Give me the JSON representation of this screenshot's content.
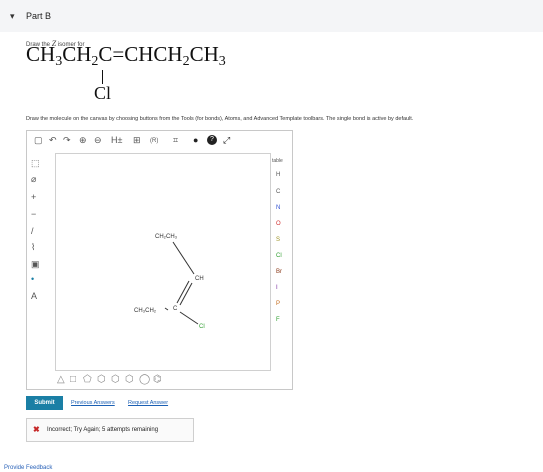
{
  "part": {
    "title": "Part B"
  },
  "question": {
    "instruction_prefix": "Draw the",
    "instruction_isomer": "Z",
    "instruction_suffix": "isomer for",
    "formula": {
      "p1": "CH",
      "s1": "3",
      "p2": "CH",
      "s2": "2",
      "p3": "C",
      "bond": "=",
      "p4": "CHCH",
      "s4": "2",
      "p5": "CH",
      "s5": "3",
      "substituent": "Cl"
    },
    "canvas_instruction": "Draw the molecule on the canvas by choosing buttons from the Tools (for bonds), Atoms, and Advanced Template toolbars. The single bond is active by default."
  },
  "editor": {
    "top_toolbar": [
      {
        "name": "document-icon",
        "glyph": "▢"
      },
      {
        "name": "undo-icon",
        "glyph": "↶"
      },
      {
        "name": "redo-icon",
        "glyph": "↷"
      },
      {
        "name": "zoom-in-icon",
        "glyph": "⊕"
      },
      {
        "name": "zoom-out-icon",
        "glyph": "⊖"
      },
      {
        "name": "hydrogen-toggle-icon",
        "glyph": "H±"
      },
      {
        "name": "label-icon",
        "glyph": "⊞"
      },
      {
        "name": "cip-icon",
        "glyph": "(R)"
      },
      {
        "name": "template-icon",
        "glyph": "⌗"
      },
      {
        "name": "info-icon",
        "glyph": "●"
      },
      {
        "name": "help-icon",
        "glyph": "?"
      },
      {
        "name": "fullscreen-icon",
        "glyph": "⤢"
      }
    ],
    "left_toolbar": [
      {
        "name": "select-icon",
        "glyph": "⬚"
      },
      {
        "name": "eraser-icon",
        "glyph": "⌀"
      },
      {
        "name": "charge-plus-icon",
        "glyph": "+"
      },
      {
        "name": "charge-minus-icon",
        "glyph": "−"
      },
      {
        "name": "single-bond-icon",
        "glyph": "/"
      },
      {
        "name": "chain-icon",
        "glyph": "⌇"
      },
      {
        "name": "ring-template-icon",
        "glyph": "▣"
      },
      {
        "name": "radical-icon",
        "glyph": "•"
      },
      {
        "name": "atom-label-icon",
        "glyph": "A"
      }
    ],
    "atoms": [
      "H",
      "C",
      "N",
      "O",
      "S",
      "Cl",
      "Br",
      "I",
      "P",
      "F"
    ],
    "atom_colors": {
      "H": "#555555",
      "C": "#555555",
      "N": "#3050d0",
      "O": "#d03030",
      "S": "#9a8f20",
      "Cl": "#2e9e2e",
      "Br": "#8b3a1a",
      "I": "#7a2ea0",
      "P": "#c46a1a",
      "F": "#2e9e2e"
    },
    "periodic_label": "table",
    "molecule_labels": {
      "top_group": "CH₂CH₃",
      "ch": "CH",
      "c": "C",
      "left_group": "CH₃CH₂",
      "cl": "Cl"
    },
    "bottom_toolbar": [
      {
        "name": "triangle-template-icon",
        "glyph": "△"
      },
      {
        "name": "square-template-icon",
        "glyph": "□"
      },
      {
        "name": "pentagon-template-icon",
        "glyph": "⬠"
      },
      {
        "name": "hexagon-template-icon",
        "glyph": "⬡"
      },
      {
        "name": "cyclohexane-template-icon",
        "glyph": "⬡"
      },
      {
        "name": "heptagon-template-icon",
        "glyph": "⬡"
      },
      {
        "name": "octagon-template-icon",
        "glyph": "◯"
      },
      {
        "name": "benzene-template-icon",
        "glyph": "⌬"
      }
    ]
  },
  "actions": {
    "submit": "Submit",
    "previous_answers": "Previous Answers",
    "request_answer": "Request Answer"
  },
  "feedback": {
    "status_color": "#c62828",
    "message": "Incorrect; Try Again; 5 attempts remaining"
  },
  "footer": {
    "provide_feedback": "Provide Feedback"
  }
}
